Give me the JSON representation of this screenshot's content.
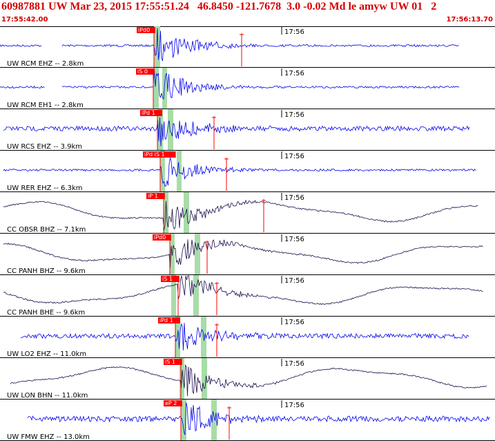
{
  "header": {
    "title": "60987881 UW Mar 23, 2015 17:55:51.24   46.8450 -121.7678  3.0 -0.02 Md le amyw UW 01   2",
    "start_time": "17:55:42.00",
    "end_time": "17:56:13.70"
  },
  "colors": {
    "header_text": "#d40000",
    "pick_box": "#ff0000",
    "pick_window": "#a8dca8",
    "trace_blue": "#0000ee",
    "trace_dark": "#1a0a4a",
    "divider": "#000000"
  },
  "traces": [
    {
      "label": "UW RCM EHZ -- 2.8km",
      "time_mark": "17:56",
      "pick": "iPd0",
      "color": "blue",
      "kind": "quiet"
    },
    {
      "label": "UW RCM EH1 -- 2.8km",
      "time_mark": "17:56",
      "pick": "iS 0",
      "color": "blue",
      "kind": "quiet"
    },
    {
      "label": "UW RCS EHZ -- 3.9km",
      "time_mark": "17:56",
      "pick": "iPd 1",
      "color": "blue",
      "kind": "noisy"
    },
    {
      "label": "UW RER EHZ -- 6.3km",
      "time_mark": "17:56",
      "pick": "iPd iS 1",
      "color": "blue",
      "kind": "quiet"
    },
    {
      "label": "CC OBSR BHZ -- 7.1km",
      "time_mark": "17:56",
      "pick": "iP 1",
      "color": "dark",
      "kind": "wave"
    },
    {
      "label": "CC PANH BHZ -- 9.6km",
      "time_mark": "17:56",
      "pick": "iPd0",
      "color": "dark",
      "kind": "wave"
    },
    {
      "label": "CC PANH BHE -- 9.6km",
      "time_mark": "17:56",
      "pick": "iS 1",
      "color": "dark",
      "kind": "wave"
    },
    {
      "label": "UW LO2 EHZ -- 11.0km",
      "time_mark": "17:56",
      "pick": "iPd 1",
      "color": "blue",
      "kind": "noisy"
    },
    {
      "label": "UW LON BHN -- 11.0km",
      "time_mark": "17:56",
      "pick": "iS 1",
      "color": "dark",
      "kind": "wave"
    },
    {
      "label": "UW FMW EHZ -- 13.0km",
      "time_mark": "17:56",
      "pick": "eP 2",
      "color": "blue",
      "kind": "noisy"
    }
  ]
}
